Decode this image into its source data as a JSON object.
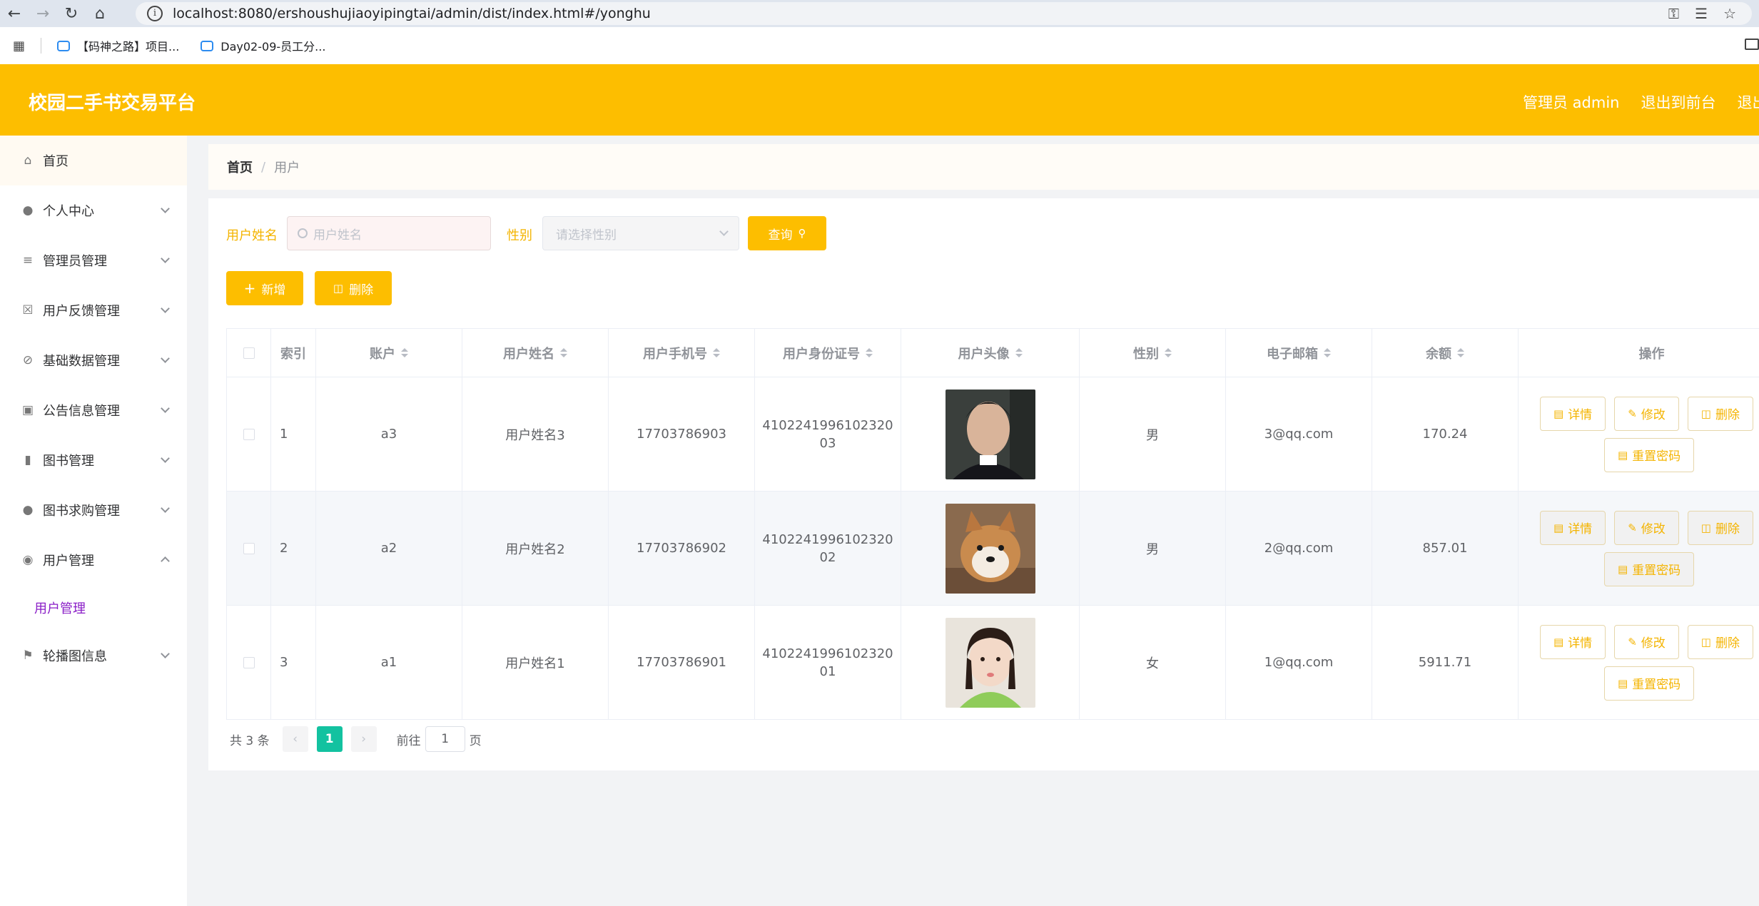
{
  "browser": {
    "url": "localhost:8080/ershoushujiaoyipingtai/admin/dist/index.html#/yonghu",
    "bookmarks": [
      "【码神之路】项目...",
      "Day02-09-员工分..."
    ]
  },
  "header": {
    "title": "校园二手书交易平台",
    "admin_label": "管理员 admin",
    "back_front": "退出到前台",
    "logout": "退出登录"
  },
  "sidebar": {
    "items": [
      {
        "label": "首页",
        "icon": "home-icon"
      },
      {
        "label": "个人中心",
        "icon": "user-icon"
      },
      {
        "label": "管理员管理",
        "icon": "sliders-icon"
      },
      {
        "label": "用户反馈管理",
        "icon": "feedback-icon"
      },
      {
        "label": "基础数据管理",
        "icon": "bell-off-icon"
      },
      {
        "label": "公告信息管理",
        "icon": "ticket-icon"
      },
      {
        "label": "图书管理",
        "icon": "bar-chart-icon"
      },
      {
        "label": "图书求购管理",
        "icon": "user-icon"
      },
      {
        "label": "用户管理",
        "icon": "location-icon"
      },
      {
        "label": "轮播图信息",
        "icon": "flag-icon"
      }
    ],
    "sub_item": "用户管理"
  },
  "breadcrumb": {
    "home": "首页",
    "current": "用户"
  },
  "filters": {
    "name_label": "用户姓名",
    "name_placeholder": "用户姓名",
    "gender_label": "性别",
    "gender_placeholder": "请选择性别",
    "search_button": "查询"
  },
  "actions": {
    "add": "新增",
    "delete": "删除"
  },
  "table": {
    "headers": [
      "索引",
      "账户",
      "用户姓名",
      "用户手机号",
      "用户身份证号",
      "用户头像",
      "性别",
      "电子邮箱",
      "余额",
      "操作"
    ],
    "rows": [
      {
        "index": "1",
        "account": "a3",
        "name": "用户姓名3",
        "phone": "17703786903",
        "idcard": "410224199610232003",
        "gender": "男",
        "email": "3@qq.com",
        "balance": "170.24"
      },
      {
        "index": "2",
        "account": "a2",
        "name": "用户姓名2",
        "phone": "17703786902",
        "idcard": "410224199610232002",
        "gender": "男",
        "email": "2@qq.com",
        "balance": "857.01"
      },
      {
        "index": "3",
        "account": "a1",
        "name": "用户姓名1",
        "phone": "17703786901",
        "idcard": "410224199610232001",
        "gender": "女",
        "email": "1@qq.com",
        "balance": "5911.71"
      }
    ],
    "op_labels": {
      "detail": "详情",
      "edit": "修改",
      "delete": "删除",
      "reset": "重置密码"
    }
  },
  "pagination": {
    "total": "共 3 条",
    "current": "1",
    "goto": "前往",
    "page_value": "1",
    "page_suffix": "页"
  },
  "colors": {
    "brand": "#fdbe00",
    "page_active": "#13c2a0",
    "submenu_active": "#8a1ec7"
  }
}
